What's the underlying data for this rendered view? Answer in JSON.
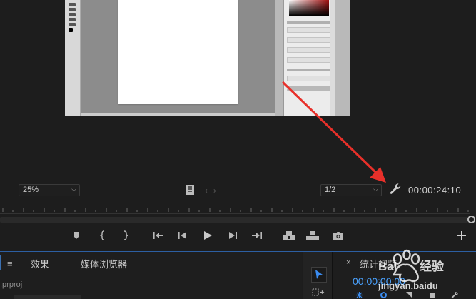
{
  "program_monitor": {
    "zoom_value": "25%",
    "resolution_value": "1/2",
    "timecode": "00:00:24:10"
  },
  "bottom_panel": {
    "menu_glyph": "≡",
    "tabs": [
      {
        "label": "效果"
      },
      {
        "label": "媒体浏览器"
      }
    ],
    "project_file": ".prproj"
  },
  "timeline": {
    "close_glyph": "×",
    "name": "统计视频",
    "timecode": "00:00:00:00"
  },
  "colors": {
    "accent_blue": "#2c5fa3",
    "timecode_blue": "#4aa2ff",
    "annotation_red": "#e8302a"
  },
  "icons": {
    "wrench": "wrench-icon",
    "film": "film-strip-icon",
    "play": "play-icon",
    "camera": "export-frame-icon",
    "add": "plus-icon",
    "selection": "selection-tool-icon"
  }
}
